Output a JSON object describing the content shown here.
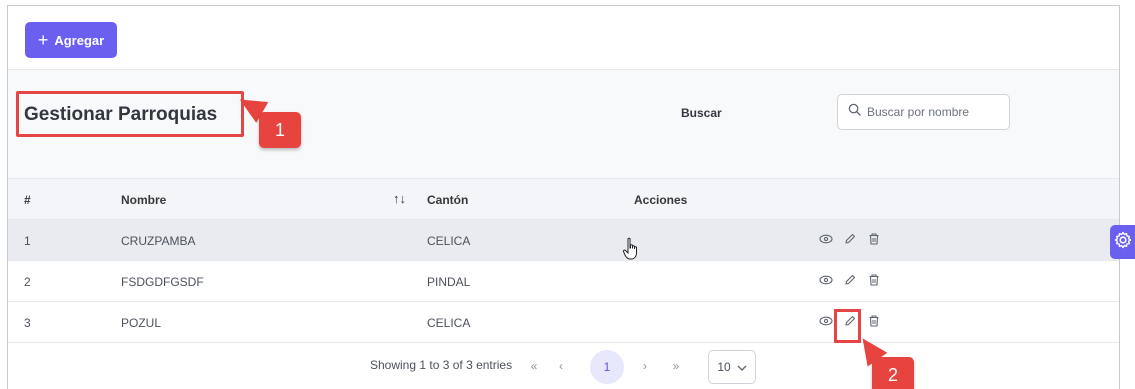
{
  "toolbar": {
    "add_label": "Agregar"
  },
  "header": {
    "title": "Gestionar Parroquias",
    "annotation_1": "1"
  },
  "search": {
    "label": "Buscar",
    "placeholder": "Buscar por nombre"
  },
  "table": {
    "columns": [
      "#",
      "Nombre",
      "Cantón",
      "Acciones"
    ],
    "sort_icon": "↑↓",
    "rows": [
      {
        "id": "1",
        "nombre": "CRUZPAMBA",
        "canton": "CELICA"
      },
      {
        "id": "2",
        "nombre": "FSDGDFGSDF",
        "canton": "PINDAL"
      },
      {
        "id": "3",
        "nombre": "POZUL",
        "canton": "CELICA"
      }
    ]
  },
  "footer": {
    "entries_text": "Showing 1 to 3 of 3 entries",
    "first": "«",
    "prev": "‹",
    "current_page": "1",
    "next": "›",
    "last": "»",
    "page_size": "10"
  },
  "annotation_2": "2",
  "colors": {
    "accent": "#6b5ff0",
    "annotation": "#e8443f"
  }
}
